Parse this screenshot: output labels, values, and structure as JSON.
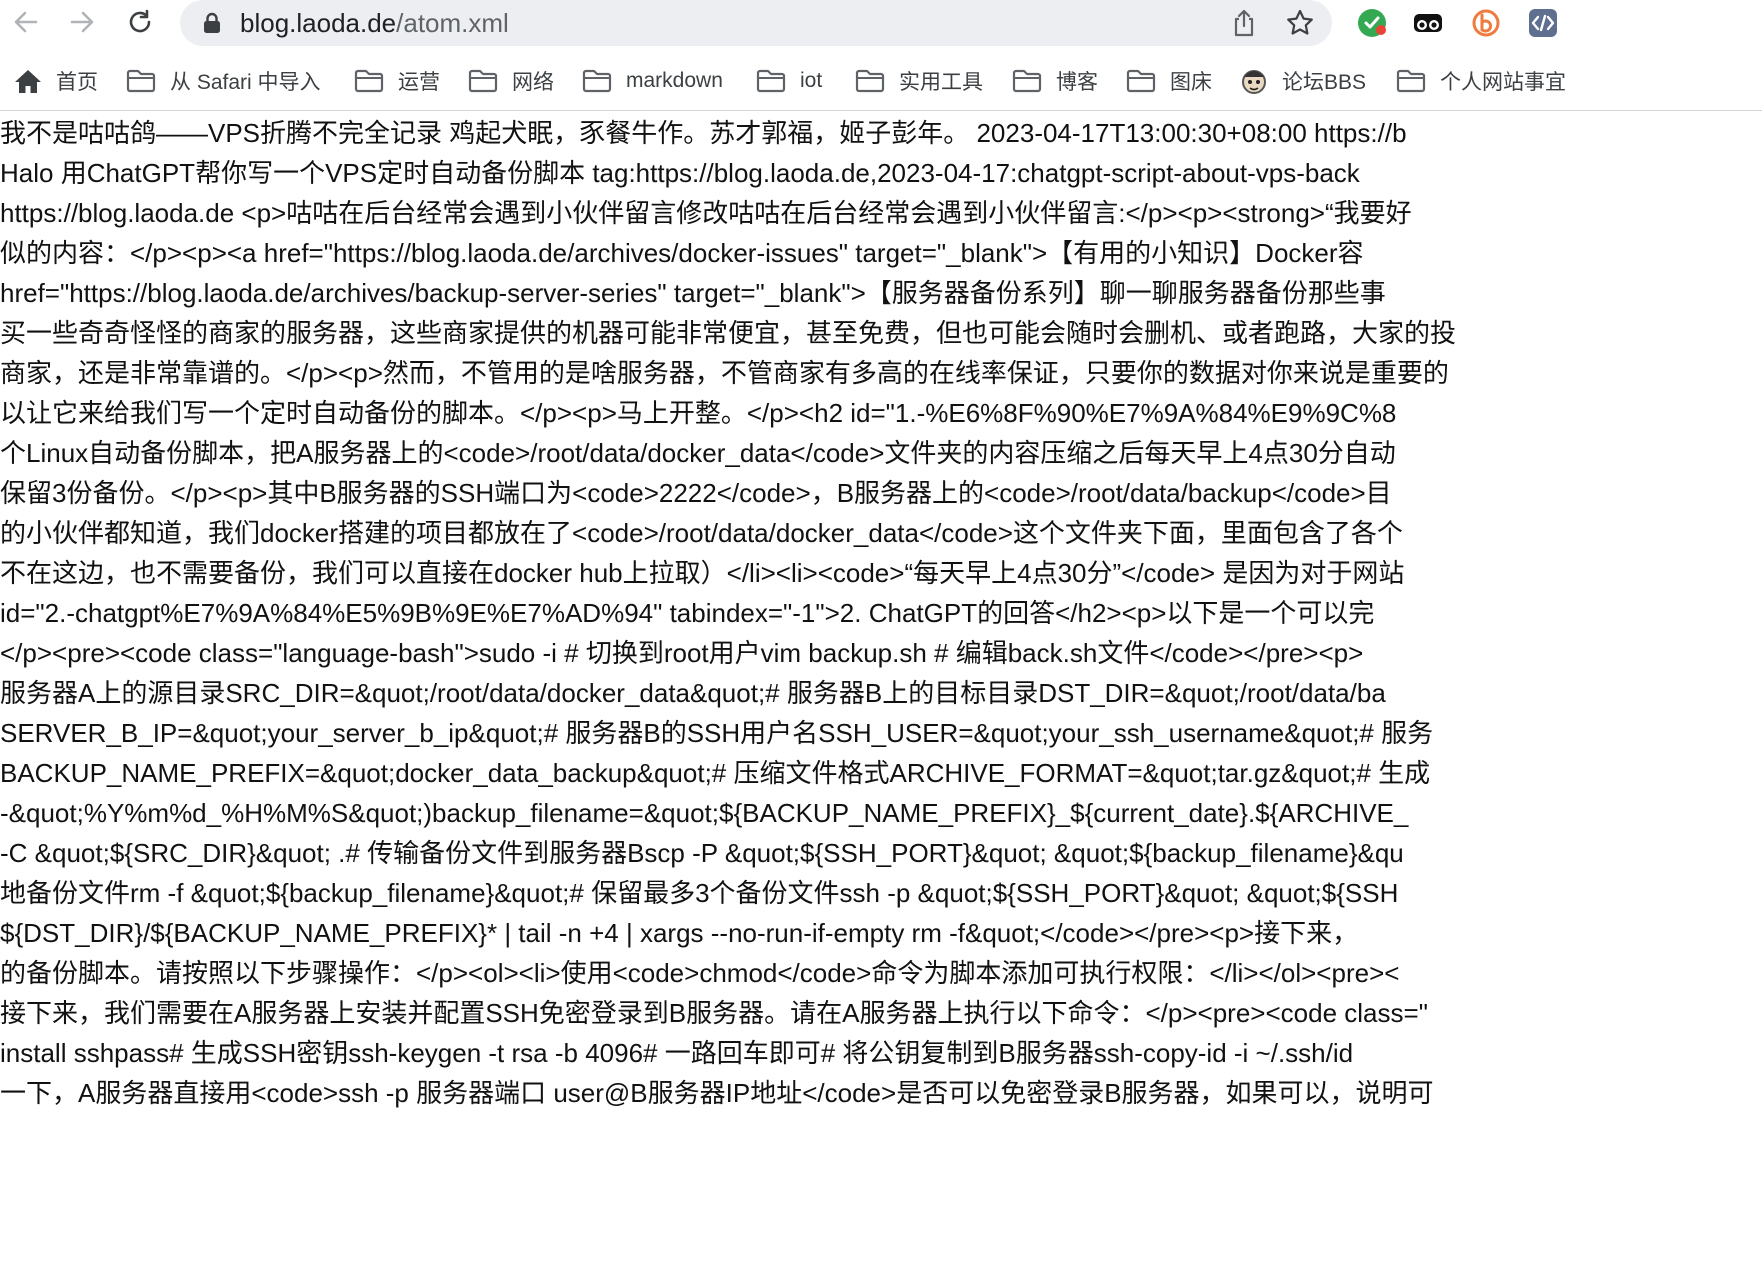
{
  "browser": {
    "url_host": "blog.laoda.de",
    "url_path": "/atom.xml",
    "icons": {
      "back": "back-arrow-icon",
      "forward": "forward-arrow-icon",
      "reload": "reload-icon",
      "lock": "lock-icon",
      "share": "share-icon",
      "bookmark": "star-icon",
      "extensions": [
        "checkmark-extension-icon",
        "glasses-extension-icon",
        "b-extension-icon",
        "code-extension-icon"
      ]
    },
    "colors": {
      "accent_green": "#34a853",
      "accent_orange": "#f07b3f",
      "toolbar_bg": "#ffffff",
      "urlbar_bg": "#eceef1"
    }
  },
  "bookmarks": [
    {
      "label": "首页",
      "icon": "home-icon"
    },
    {
      "label": "从 Safari 中导入",
      "icon": "folder-icon"
    },
    {
      "label": "运营",
      "icon": "folder-icon"
    },
    {
      "label": "网络",
      "icon": "folder-icon"
    },
    {
      "label": "markdown",
      "icon": "folder-icon"
    },
    {
      "label": "iot",
      "icon": "folder-icon"
    },
    {
      "label": "实用工具",
      "icon": "folder-icon"
    },
    {
      "label": "博客",
      "icon": "folder-icon"
    },
    {
      "label": "图床",
      "icon": "folder-icon"
    },
    {
      "label": "论坛BBS",
      "icon": "avatar-icon"
    },
    {
      "label": "个人网站事宜",
      "icon": "folder-icon"
    }
  ],
  "content_lines": [
    "我不是咕咕鸽——VPS折腾不完全记录 鸡起犬眠，豕餐牛作。苏才郭福，姬子彭年。 2023-04-17T13:00:30+08:00 https://b",
    "Halo 用ChatGPT帮你写一个VPS定时自动备份脚本 tag:https://blog.laoda.de,2023-04-17:chatgpt-script-about-vps-back",
    "https://blog.laoda.de <p>咕咕在后台经常会遇到小伙伴留言修改咕咕在后台经常会遇到小伙伴留言:</p><p><strong>“我要好",
    "似的内容：</p><p><a href=\"https://blog.laoda.de/archives/docker-issues\" target=\"_blank\">【有用的小知识】Docker容",
    "href=\"https://blog.laoda.de/archives/backup-server-series\" target=\"_blank\">【服务器备份系列】聊一聊服务器备份那些事",
    "买一些奇奇怪怪的商家的服务器，这些商家提供的机器可能非常便宜，甚至免费，但也可能会随时会删机、或者跑路，大家的投",
    "商家，还是非常靠谱的。</p><p>然而，不管用的是啥服务器，不管商家有多高的在线率保证，只要你的数据对你来说是重要的",
    "以让它来给我们写一个定时自动备份的脚本。</p><p>马上开整。</p><h2 id=\"1.-%E6%8F%90%E7%9A%84%E9%9C%8",
    "个Linux自动备份脚本，把A服务器上的<code>/root/data/docker_data</code>文件夹的内容压缩之后每天早上4点30分自动",
    "保留3份备份。</p><p>其中B服务器的SSH端口为<code>2222</code>，B服务器上的<code>/root/data/backup</code>目",
    "的小伙伴都知道，我们docker搭建的项目都放在了<code>/root/data/docker_data</code>这个文件夹下面，里面包含了各个",
    "不在这边，也不需要备份，我们可以直接在docker hub上拉取）</li><li><code>“每天早上4点30分”</code> 是因为对于网站",
    "id=\"2.-chatgpt%E7%9A%84%E5%9B%9E%E7%AD%94\" tabindex=\"-1\">2. ChatGPT的回答</h2><p>以下是一个可以完",
    "</p><pre><code class=\"language-bash\">sudo -i # 切换到root用户vim backup.sh # 编辑back.sh文件</code></pre><p>",
    "服务器A上的源目录SRC_DIR=&quot;/root/data/docker_data&quot;# 服务器B上的目标目录DST_DIR=&quot;/root/data/ba",
    "SERVER_B_IP=&quot;your_server_b_ip&quot;# 服务器B的SSH用户名SSH_USER=&quot;your_ssh_username&quot;# 服务",
    "BACKUP_NAME_PREFIX=&quot;docker_data_backup&quot;# 压缩文件格式ARCHIVE_FORMAT=&quot;tar.gz&quot;# 生成",
    "-&quot;%Y%m%d_%H%M%S&quot;)backup_filename=&quot;${BACKUP_NAME_PREFIX}_${current_date}.${ARCHIVE_",
    "-C &quot;${SRC_DIR}&quot; .# 传输备份文件到服务器Bscp -P &quot;${SSH_PORT}&quot; &quot;${backup_filename}&qu",
    "地备份文件rm -f &quot;${backup_filename}&quot;# 保留最多3个备份文件ssh -p &quot;${SSH_PORT}&quot; &quot;${SSH",
    "${DST_DIR}/${BACKUP_NAME_PREFIX}* | tail -n +4 | xargs --no-run-if-empty rm -f&quot;</code></pre><p>接下来，",
    "的备份脚本。请按照以下步骤操作：</p><ol><li>使用<code>chmod</code>命令为脚本添加可执行权限：</li></ol><pre><",
    "接下来，我们需要在A服务器上安装并配置SSH免密登录到B服务器。请在A服务器上执行以下命令：</p><pre><code class=\"",
    "install sshpass# 生成SSH密钥ssh-keygen -t rsa -b 4096# 一路回车即可# 将公钥复制到B服务器ssh-copy-id -i ~/.ssh/id",
    "一下，A服务器直接用<code>ssh -p 服务器端口 user@B服务器IP地址</code>是否可以免密登录B服务器，如果可以，说明可"
  ]
}
